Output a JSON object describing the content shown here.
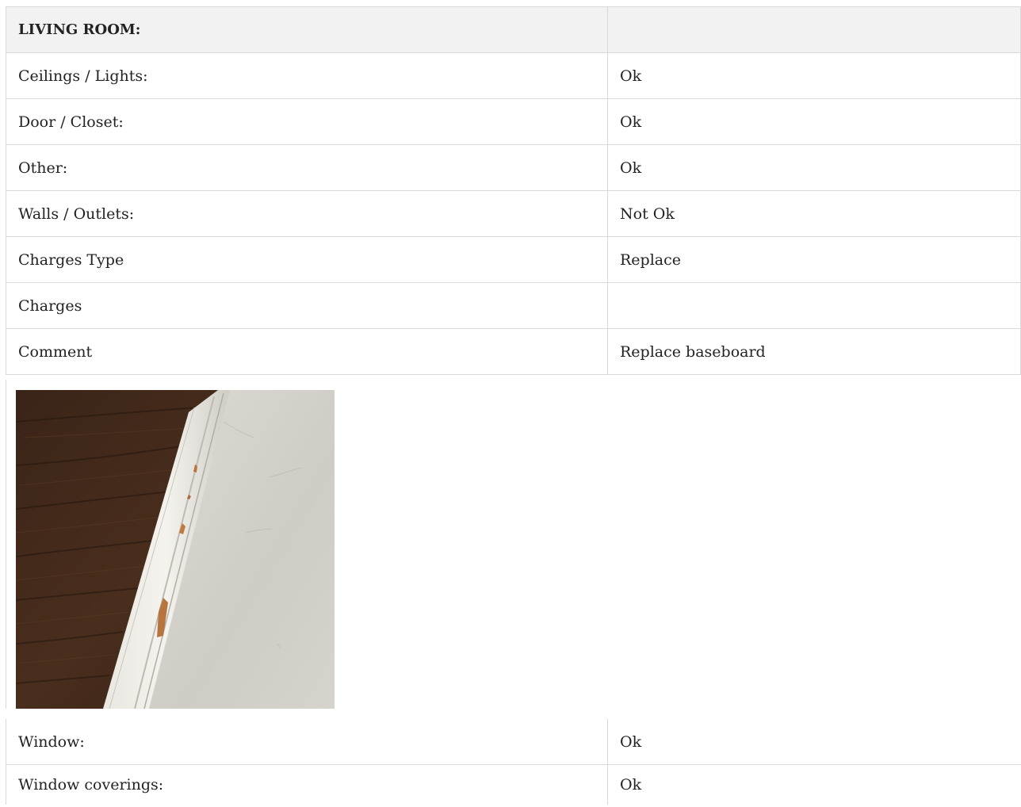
{
  "section": {
    "title": "LIVING ROOM:",
    "title_value": ""
  },
  "rows": [
    {
      "label": "Ceilings / Lights:",
      "value": "Ok"
    },
    {
      "label": "Door / Closet:",
      "value": "Ok"
    },
    {
      "label": "Other:",
      "value": "Ok"
    },
    {
      "label": "Walls / Outlets:",
      "value": "Not Ok"
    },
    {
      "label": "Charges Type",
      "value": "Replace"
    },
    {
      "label": "Charges",
      "value": ""
    },
    {
      "label": "Comment",
      "value": "Replace baseboard"
    }
  ],
  "photo": {
    "subject": "damaged-baseboard-photo"
  },
  "more_rows": [
    {
      "label": "Window:",
      "value": "Ok"
    },
    {
      "label": "Window coverings:",
      "value": "Ok"
    }
  ],
  "colors": {
    "border": "#d9d9d9",
    "header_bg": "#f2f2f2",
    "text": "#222222"
  }
}
